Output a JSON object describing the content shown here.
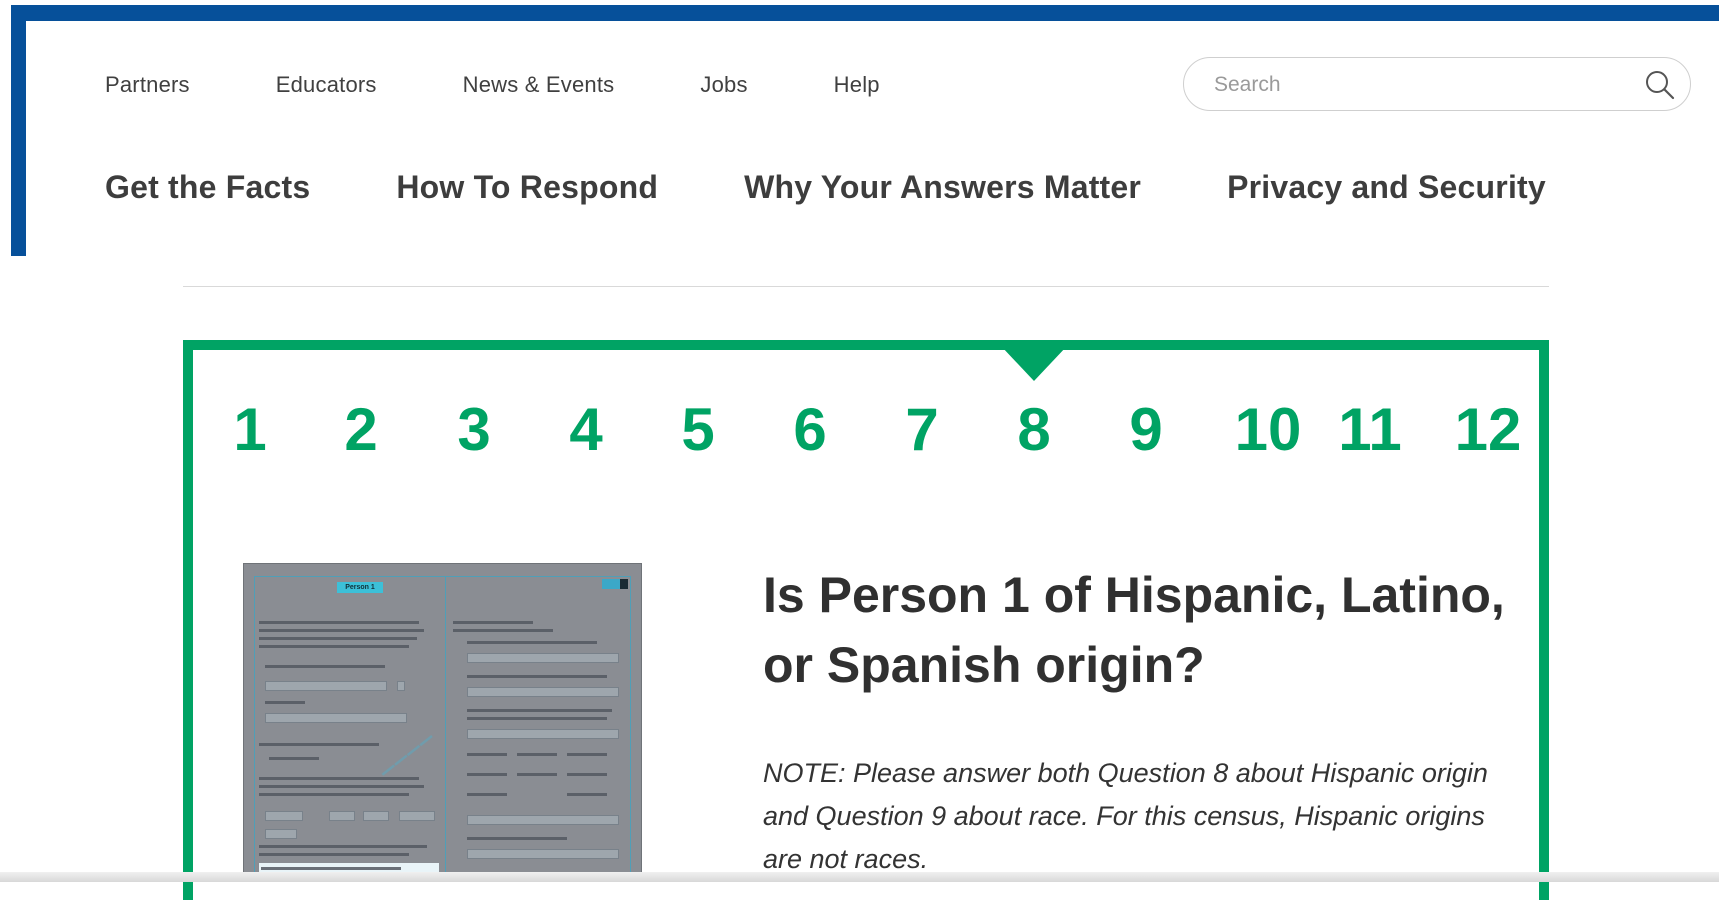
{
  "utility_nav": [
    "Partners",
    "Educators",
    "News & Events",
    "Jobs",
    "Help"
  ],
  "search": {
    "placeholder": "Search"
  },
  "main_nav": [
    "Get the Facts",
    "How To Respond",
    "Why Your Answers Matter",
    "Privacy and Security"
  ],
  "steps": [
    "1",
    "2",
    "3",
    "4",
    "5",
    "6",
    "7",
    "8",
    "9",
    "10",
    "11",
    "12"
  ],
  "active_step": "8",
  "form_thumbnail": {
    "header": "Person 1"
  },
  "question": {
    "title": "Is Person 1 of Hispanic, Latino, or Spanish origin?",
    "note": "NOTE: Please answer both Question 8 about Hispanic origin and Question 9 about race.  For this census, Hispanic origins are not races."
  },
  "colors": {
    "brand_blue": "#06509a",
    "accent_green": "#00a364"
  }
}
